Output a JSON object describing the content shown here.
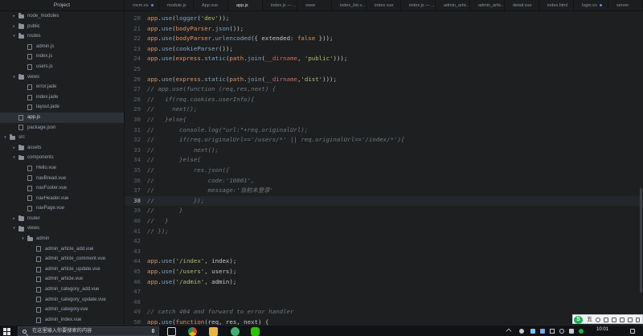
{
  "sidebar": {
    "title": "Project",
    "rows": [
      {
        "kind": "folder",
        "depth": 1,
        "arrow": "▸",
        "label": "node_modules"
      },
      {
        "kind": "folder",
        "depth": 1,
        "arrow": "▸",
        "label": "public"
      },
      {
        "kind": "folder",
        "depth": 1,
        "arrow": "▾",
        "label": "routes"
      },
      {
        "kind": "file",
        "depth": 2,
        "arrow": "",
        "label": "admin.js"
      },
      {
        "kind": "file",
        "depth": 2,
        "arrow": "",
        "label": "index.js"
      },
      {
        "kind": "file",
        "depth": 2,
        "arrow": "",
        "label": "users.js"
      },
      {
        "kind": "folder",
        "depth": 1,
        "arrow": "▾",
        "label": "views"
      },
      {
        "kind": "file",
        "depth": 2,
        "arrow": "",
        "label": "error.jade"
      },
      {
        "kind": "file",
        "depth": 2,
        "arrow": "",
        "label": "index.jade"
      },
      {
        "kind": "file",
        "depth": 2,
        "arrow": "",
        "label": "layout.jade"
      },
      {
        "kind": "file",
        "depth": 1,
        "arrow": "",
        "label": "app.js",
        "selected": true
      },
      {
        "kind": "file",
        "depth": 1,
        "arrow": "",
        "label": "package.json"
      },
      {
        "kind": "folder",
        "depth": 0,
        "arrow": "▾",
        "label": "src"
      },
      {
        "kind": "folder",
        "depth": 1,
        "arrow": "▸",
        "label": "assets"
      },
      {
        "kind": "folder",
        "depth": 1,
        "arrow": "▾",
        "label": "components"
      },
      {
        "kind": "file",
        "depth": 2,
        "arrow": "",
        "label": "Hello.vue"
      },
      {
        "kind": "file",
        "depth": 2,
        "arrow": "",
        "label": "navBread.vue"
      },
      {
        "kind": "file",
        "depth": 2,
        "arrow": "",
        "label": "navFooter.vue"
      },
      {
        "kind": "file",
        "depth": 2,
        "arrow": "",
        "label": "navHeader.vue"
      },
      {
        "kind": "file",
        "depth": 2,
        "arrow": "",
        "label": "navPage.vue"
      },
      {
        "kind": "folder",
        "depth": 1,
        "arrow": "▸",
        "label": "router"
      },
      {
        "kind": "folder",
        "depth": 1,
        "arrow": "▾",
        "label": "views"
      },
      {
        "kind": "folder",
        "depth": 2,
        "arrow": "▾",
        "label": "admin"
      },
      {
        "kind": "file",
        "depth": 3,
        "arrow": "",
        "label": "admin_article_add.vue"
      },
      {
        "kind": "file",
        "depth": 3,
        "arrow": "",
        "label": "admin_article_comment.vue"
      },
      {
        "kind": "file",
        "depth": 3,
        "arrow": "",
        "label": "admin_article_update.vue"
      },
      {
        "kind": "file",
        "depth": 3,
        "arrow": "",
        "label": "admin_article.vue"
      },
      {
        "kind": "file",
        "depth": 3,
        "arrow": "",
        "label": "admin_category_add.vue"
      },
      {
        "kind": "file",
        "depth": 3,
        "arrow": "",
        "label": "admin_category_update.vue"
      },
      {
        "kind": "file",
        "depth": 3,
        "arrow": "",
        "label": "admin_category.vue"
      },
      {
        "kind": "file",
        "depth": 3,
        "arrow": "",
        "label": "admin_index.vue"
      }
    ]
  },
  "tabs": [
    {
      "label": "rocm.vu",
      "modified": true
    },
    {
      "label": "module.js",
      "modified": false
    },
    {
      "label": "App.vue",
      "modified": false
    },
    {
      "label": "app.js",
      "active": true,
      "modified": false
    },
    {
      "label": "index.js — ...",
      "modified": false
    },
    {
      "label": "www",
      "modified": false
    },
    {
      "label": "index_list.v...",
      "modified": false
    },
    {
      "label": "index.vue",
      "modified": false
    },
    {
      "label": "index.js — ...",
      "modified": false
    },
    {
      "label": "admin_artic...",
      "modified": false
    },
    {
      "label": "admin_artic...",
      "modified": false
    },
    {
      "label": "detail.vue",
      "modified": false
    },
    {
      "label": "index.html",
      "modified": false
    },
    {
      "label": "login.vu",
      "modified": true
    },
    {
      "label": "server",
      "modified": false
    }
  ],
  "editor": {
    "cursor_line": 38,
    "lines": [
      {
        "n": "20",
        "tokens": [
          [
            "kw",
            "app"
          ],
          [
            "p",
            "."
          ],
          [
            "fn",
            "use"
          ],
          [
            "p",
            "("
          ],
          [
            "fn",
            "logger"
          ],
          [
            "p",
            "("
          ],
          [
            "str",
            "'dev'"
          ],
          [
            "p",
            "));"
          ]
        ]
      },
      {
        "n": "21",
        "tokens": [
          [
            "kw",
            "app"
          ],
          [
            "p",
            "."
          ],
          [
            "fn",
            "use"
          ],
          [
            "p",
            "("
          ],
          [
            "kw",
            "bodyParser"
          ],
          [
            "p",
            "."
          ],
          [
            "fn",
            "json"
          ],
          [
            "p",
            "());"
          ]
        ]
      },
      {
        "n": "22",
        "tokens": [
          [
            "kw",
            "app"
          ],
          [
            "p",
            "."
          ],
          [
            "fn",
            "use"
          ],
          [
            "p",
            "("
          ],
          [
            "kw",
            "bodyParser"
          ],
          [
            "p",
            "."
          ],
          [
            "fn",
            "urlencoded"
          ],
          [
            "p",
            "({ extended: "
          ],
          [
            "num",
            "false"
          ],
          [
            "p",
            " }));"
          ]
        ]
      },
      {
        "n": "23",
        "tokens": [
          [
            "kw",
            "app"
          ],
          [
            "p",
            "."
          ],
          [
            "fn",
            "use"
          ],
          [
            "p",
            "("
          ],
          [
            "fn",
            "cookieParser"
          ],
          [
            "p",
            "());"
          ]
        ]
      },
      {
        "n": "24",
        "tokens": [
          [
            "kw",
            "app"
          ],
          [
            "p",
            "."
          ],
          [
            "fn",
            "use"
          ],
          [
            "p",
            "("
          ],
          [
            "kw",
            "express"
          ],
          [
            "p",
            "."
          ],
          [
            "fn",
            "static"
          ],
          [
            "p",
            "("
          ],
          [
            "kw",
            "path"
          ],
          [
            "p",
            "."
          ],
          [
            "fn",
            "join"
          ],
          [
            "p",
            "("
          ],
          [
            "v",
            "__dirname"
          ],
          [
            "p",
            ", "
          ],
          [
            "str",
            "'public'"
          ],
          [
            "p",
            ")));"
          ]
        ]
      },
      {
        "n": "25",
        "tokens": []
      },
      {
        "n": "26",
        "tokens": [
          [
            "kw",
            "app"
          ],
          [
            "p",
            "."
          ],
          [
            "fn",
            "use"
          ],
          [
            "p",
            "("
          ],
          [
            "kw",
            "express"
          ],
          [
            "p",
            "."
          ],
          [
            "fn",
            "static"
          ],
          [
            "p",
            "("
          ],
          [
            "kw",
            "path"
          ],
          [
            "p",
            "."
          ],
          [
            "fn",
            "join"
          ],
          [
            "p",
            "("
          ],
          [
            "v",
            "__dirname"
          ],
          [
            "p",
            ","
          ],
          [
            "str",
            "'dist'"
          ],
          [
            "p",
            ")));"
          ]
        ]
      },
      {
        "n": "27",
        "tokens": [
          [
            "c",
            "// app.use(function (req,res,next) {"
          ]
        ]
      },
      {
        "n": "28",
        "tokens": [
          [
            "c",
            "//   if(req.cookies.userInfo){"
          ]
        ]
      },
      {
        "n": "29",
        "tokens": [
          [
            "c",
            "//     next();"
          ]
        ]
      },
      {
        "n": "30",
        "tokens": [
          [
            "c",
            "//   }else{"
          ]
        ]
      },
      {
        "n": "31",
        "tokens": [
          [
            "c",
            "//       console.log(\"url:\"+req.originalUrl);"
          ]
        ]
      },
      {
        "n": "32",
        "tokens": [
          [
            "c",
            "//       if(req.originalUrl=='/users/*' || req.originalUrl=='/index/*'){"
          ]
        ]
      },
      {
        "n": "33",
        "tokens": [
          [
            "c",
            "//           next();"
          ]
        ]
      },
      {
        "n": "34",
        "tokens": [
          [
            "c",
            "//       }else{"
          ]
        ]
      },
      {
        "n": "35",
        "tokens": [
          [
            "c",
            "//           res.json({"
          ]
        ]
      },
      {
        "n": "36",
        "tokens": [
          [
            "c",
            "//               code:'10001',"
          ]
        ]
      },
      {
        "n": "37",
        "tokens": [
          [
            "c",
            "//               message:'当前未登录'"
          ]
        ]
      },
      {
        "n": "38",
        "tokens": [
          [
            "c",
            "//           });"
          ]
        ]
      },
      {
        "n": "39",
        "tokens": [
          [
            "c",
            "//       }"
          ]
        ]
      },
      {
        "n": "40",
        "tokens": [
          [
            "c",
            "//   }"
          ]
        ]
      },
      {
        "n": "41",
        "tokens": [
          [
            "c",
            "// });"
          ]
        ]
      },
      {
        "n": "42",
        "tokens": []
      },
      {
        "n": "43",
        "tokens": []
      },
      {
        "n": "44",
        "tokens": [
          [
            "kw",
            "app"
          ],
          [
            "p",
            "."
          ],
          [
            "fn",
            "use"
          ],
          [
            "p",
            "("
          ],
          [
            "str",
            "'/index'"
          ],
          [
            "p",
            ", index);"
          ]
        ]
      },
      {
        "n": "45",
        "tokens": [
          [
            "kw",
            "app"
          ],
          [
            "p",
            "."
          ],
          [
            "fn",
            "use"
          ],
          [
            "p",
            "("
          ],
          [
            "str",
            "'/users'"
          ],
          [
            "p",
            ", users);"
          ]
        ]
      },
      {
        "n": "46",
        "tokens": [
          [
            "kw",
            "app"
          ],
          [
            "p",
            "."
          ],
          [
            "fn",
            "use"
          ],
          [
            "p",
            "("
          ],
          [
            "str",
            "'/admin'"
          ],
          [
            "p",
            ", admin);"
          ]
        ]
      },
      {
        "n": "47",
        "tokens": []
      },
      {
        "n": "48",
        "tokens": []
      },
      {
        "n": "49",
        "tokens": [
          [
            "c",
            "// catch 404 and forward to error handler"
          ]
        ]
      },
      {
        "n": "50",
        "tokens": [
          [
            "kw",
            "app"
          ],
          [
            "p",
            "."
          ],
          [
            "fn",
            "use"
          ],
          [
            "p",
            "("
          ],
          [
            "kw",
            "function"
          ],
          [
            "p",
            "(req, res, next) {"
          ]
        ]
      }
    ]
  },
  "taskbar": {
    "search_placeholder": "在这里输入你要搜索的内容",
    "clock": "10:01",
    "apps": [
      "task-view",
      "chrome",
      "file-explorer",
      "atom",
      "wechat"
    ]
  },
  "ime": {
    "logo": "S",
    "char": "五"
  }
}
